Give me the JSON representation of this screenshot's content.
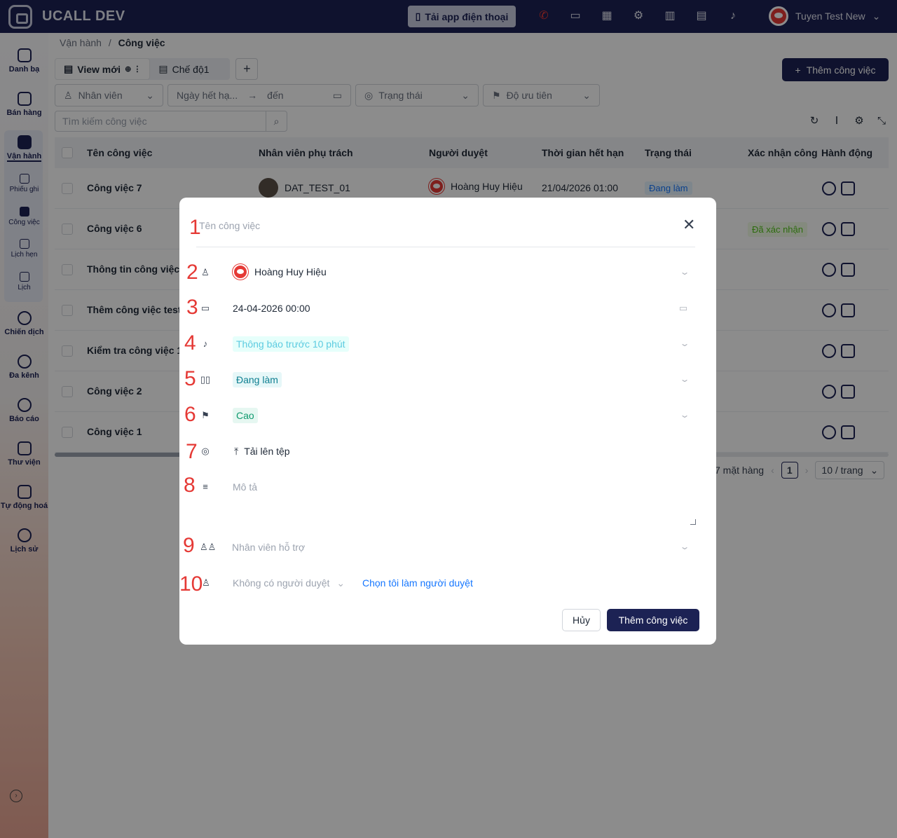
{
  "app": {
    "name": "UCALL DEV",
    "app_button": "Tải app điện thoại",
    "user_name": "Tuyen Test New"
  },
  "sidebar": {
    "items": [
      {
        "label": "Danh bạ",
        "icon": "contacts-icon"
      },
      {
        "label": "Bán hàng",
        "icon": "store-icon"
      },
      {
        "label": "Vận hành",
        "icon": "briefcase-icon"
      },
      {
        "label": "Chiến dịch",
        "icon": "target-icon"
      },
      {
        "label": "Đa kênh",
        "icon": "chat-icon"
      },
      {
        "label": "Báo cáo",
        "icon": "report-icon"
      },
      {
        "label": "Thư viện",
        "icon": "library-icon"
      },
      {
        "label": "Tự động hoá",
        "icon": "automation-icon"
      },
      {
        "label": "Lịch sử",
        "icon": "history-icon"
      }
    ],
    "sub_items": [
      {
        "label": "Phiếu ghi",
        "icon": "ticket-icon"
      },
      {
        "label": "Công việc",
        "icon": "task-icon"
      },
      {
        "label": "Lịch hẹn",
        "icon": "appointment-icon"
      },
      {
        "label": "Lịch",
        "icon": "calendar-icon"
      }
    ]
  },
  "breadcrumb": {
    "parent": "Vận hành",
    "separator": "/",
    "current": "Công việc"
  },
  "views": {
    "tabs": [
      {
        "label": "View mới"
      },
      {
        "label": "Chế độ1"
      }
    ],
    "add": "+"
  },
  "toolbar": {
    "add_task": "Thêm công việc"
  },
  "filters": {
    "employee": "Nhân viên",
    "date_from": "Ngày hết hạ...",
    "date_arrow": "→",
    "date_to": "đến",
    "status": "Trạng thái",
    "priority": "Độ ưu tiên",
    "search_placeholder": "Tìm kiếm công việc"
  },
  "table": {
    "columns": [
      "Tên công việc",
      "Nhân viên phụ trách",
      "Người duyệt",
      "Thời gian hết hạn",
      "Trạng thái",
      "Xác nhận công",
      "Hành động"
    ],
    "rows": [
      {
        "name": "Công việc 7",
        "assignee": "DAT_TEST_01",
        "approver": "Hoàng Huy Hiệu",
        "deadline": "21/04/2026 01:00",
        "status": "Đang làm",
        "confirm": ""
      },
      {
        "name": "Công việc 6",
        "assignee": "",
        "approver": "",
        "deadline": "",
        "status": "",
        "confirm": "Đã xác nhận"
      },
      {
        "name": "Thông tin công việc",
        "assignee": "",
        "approver": "",
        "deadline": "",
        "status": "",
        "confirm": ""
      },
      {
        "name": "Thêm công việc test",
        "assignee": "",
        "approver": "",
        "deadline": "",
        "status": "",
        "confirm": ""
      },
      {
        "name": "Kiểm tra công việc 1",
        "assignee": "",
        "approver": "",
        "deadline": "",
        "status": "",
        "confirm": ""
      },
      {
        "name": "Công việc 2",
        "assignee": "",
        "approver": "",
        "deadline": "",
        "status": "",
        "confirm": ""
      },
      {
        "name": "Công việc 1",
        "assignee": "",
        "approver": "",
        "deadline": "",
        "status": "",
        "confirm": ""
      }
    ]
  },
  "pagination": {
    "total": "7 mặt hàng",
    "page": "1",
    "page_size": "10 / trang"
  },
  "modal": {
    "title_placeholder": "Tên công việc",
    "numbers": [
      "1",
      "2",
      "3",
      "4",
      "5",
      "6",
      "7",
      "8",
      "9",
      "10"
    ],
    "assignee": "Hoàng Huy Hiệu",
    "deadline": "24-04-2026 00:00",
    "reminder": "Thông báo trước 10 phút",
    "status": "Đang làm",
    "priority": "Cao",
    "upload": "Tải lên tệp",
    "description_placeholder": "Mô tả",
    "support_placeholder": "Nhân viên hỗ trợ",
    "approver_placeholder": "Không có người duyệt",
    "approver_self_link": "Chọn tôi làm người duyệt",
    "cancel": "Hủy",
    "submit": "Thêm công việc"
  },
  "colors": {
    "brand": "#1c2254",
    "link": "#1677ff",
    "annotation": "#e53935"
  }
}
